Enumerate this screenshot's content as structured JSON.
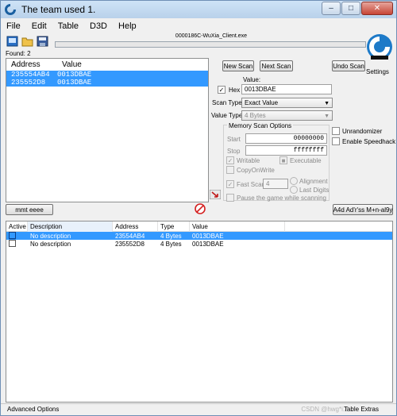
{
  "window": {
    "title": "The team used 1."
  },
  "menu": [
    "File",
    "Edit",
    "Table",
    "D3D",
    "Help"
  ],
  "process_title": "0000186C-WuXia_Client.exe",
  "found_label": "Found: 2",
  "results": {
    "headers": [
      "Address",
      "Value"
    ],
    "rows": [
      {
        "address": "235554AB4",
        "value": "0013DBAE"
      },
      {
        "address": "235552D8",
        "value": "0013DBAE"
      }
    ]
  },
  "buttons": {
    "new_scan": "New Scan",
    "next_scan": "Next Scan",
    "undo_scan": "Undo Scan",
    "memory_view": "mmt eeee",
    "add_address": "A4d Ad'r'ss M+n-al9y"
  },
  "settings_label": "Settings",
  "value": {
    "label": "Value:",
    "hex_label": "Hex",
    "hex_checked": true,
    "input": "0013DBAE"
  },
  "scan_type": {
    "label": "Scan Type",
    "selected": "Exact Value"
  },
  "value_type": {
    "label": "Value Type",
    "selected": "4 Bytes"
  },
  "memory_options": {
    "title": "Memory Scan Options",
    "start_label": "Start",
    "start_value": "00000000",
    "stop_label": "Stop",
    "stop_value": "ffffffff",
    "writable": "Writable",
    "executable": "Executable",
    "copy_on_write": "CopyOnWrite",
    "fast_scan": "Fast Scan",
    "fast_scan_value": "4",
    "alignment": "Alignment",
    "last_digits": "Last Digits",
    "pause": "Pause the game while scanning"
  },
  "side_options": {
    "unrandomizer": "Unrandomizer",
    "enable_speedhack": "Enable Speedhack"
  },
  "address_table": {
    "headers": [
      "Active",
      "Description",
      "Address",
      "Type",
      "Value"
    ],
    "rows": [
      {
        "description": "No description",
        "address": "23554AB4",
        "type": "4 Bytes",
        "value": "0013DBAE"
      },
      {
        "description": "No description",
        "address": "235552D8",
        "type": "4 Bytes",
        "value": "0013DBAE"
      }
    ]
  },
  "status": {
    "advanced": "Advanced Options",
    "table_extras": "Table Extras",
    "watermark": "CSDN @hwg*i.Z"
  },
  "colors": {
    "selection": "#3399ff",
    "progress": "#06b025",
    "accent_red": "#d42020"
  }
}
